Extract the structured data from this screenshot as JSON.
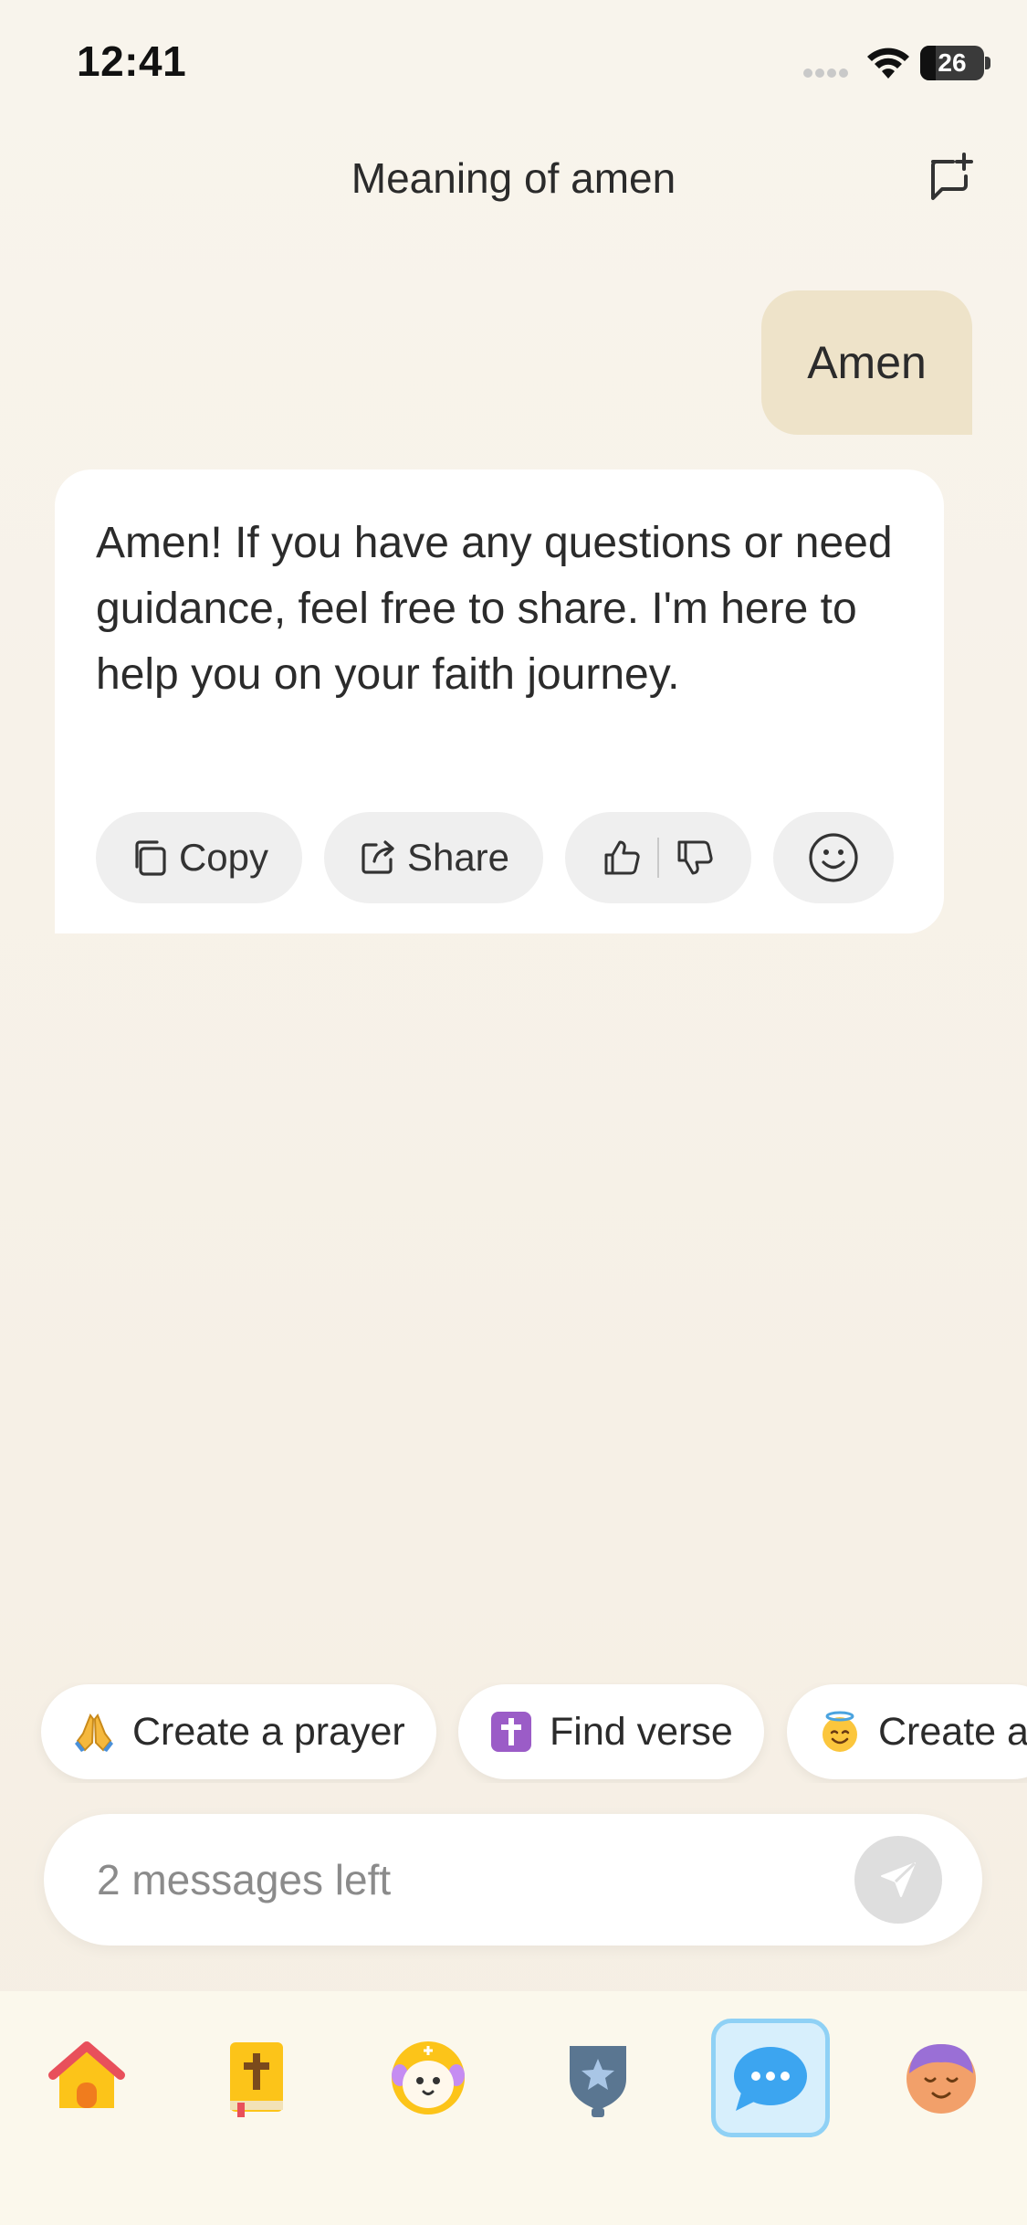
{
  "status_bar": {
    "time": "12:41",
    "battery": "26"
  },
  "header": {
    "title": "Meaning of amen",
    "new_chat_icon": "new-chat-icon"
  },
  "conversation": {
    "user_message": "Amen",
    "assistant_message": "Amen! If you have any questions or need guidance, feel free to share. I'm here to help you on your faith journey.",
    "actions": {
      "copy_label": "Copy",
      "share_label": "Share"
    }
  },
  "suggestions": [
    {
      "icon": "praying-hands-icon",
      "label": "Create a prayer"
    },
    {
      "icon": "cross-icon",
      "label": "Find verse"
    },
    {
      "icon": "halo-face-icon",
      "label": "Create a"
    }
  ],
  "composer": {
    "placeholder": "2 messages left"
  },
  "tabs": [
    {
      "icon": "home-icon"
    },
    {
      "icon": "bible-icon"
    },
    {
      "icon": "lamb-icon"
    },
    {
      "icon": "badge-icon"
    },
    {
      "icon": "chat-icon",
      "active": true
    },
    {
      "icon": "profile-icon"
    }
  ],
  "colors": {
    "accent": "#8fd1f5",
    "user_bubble": "#eee3c9",
    "background": "#f7f2e9"
  }
}
